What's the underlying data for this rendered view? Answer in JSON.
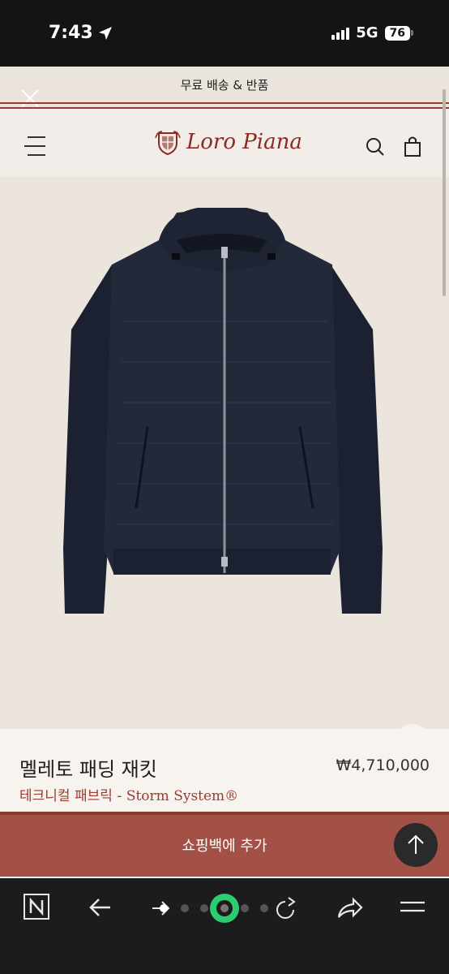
{
  "status_bar": {
    "time": "7:43",
    "network": "5G",
    "battery": "76"
  },
  "promo": {
    "text": "무료 배송 & 반품"
  },
  "header": {
    "logo_text": "Loro Piana"
  },
  "carousel": {
    "total": 5,
    "active_index": 4
  },
  "product": {
    "name": "멜레토 패딩 재킷",
    "price": "₩4,710,000",
    "subtitle_ko": "테크니컬 패브릭 - ",
    "subtitle_en": "Storm System®"
  },
  "cta": {
    "label": "쇼핑백에 추가"
  },
  "colors": {
    "accent": "#9b3a2f",
    "cta": "#a35147",
    "background": "#f2ede8",
    "active_tab_ring": "#2ecc71"
  }
}
